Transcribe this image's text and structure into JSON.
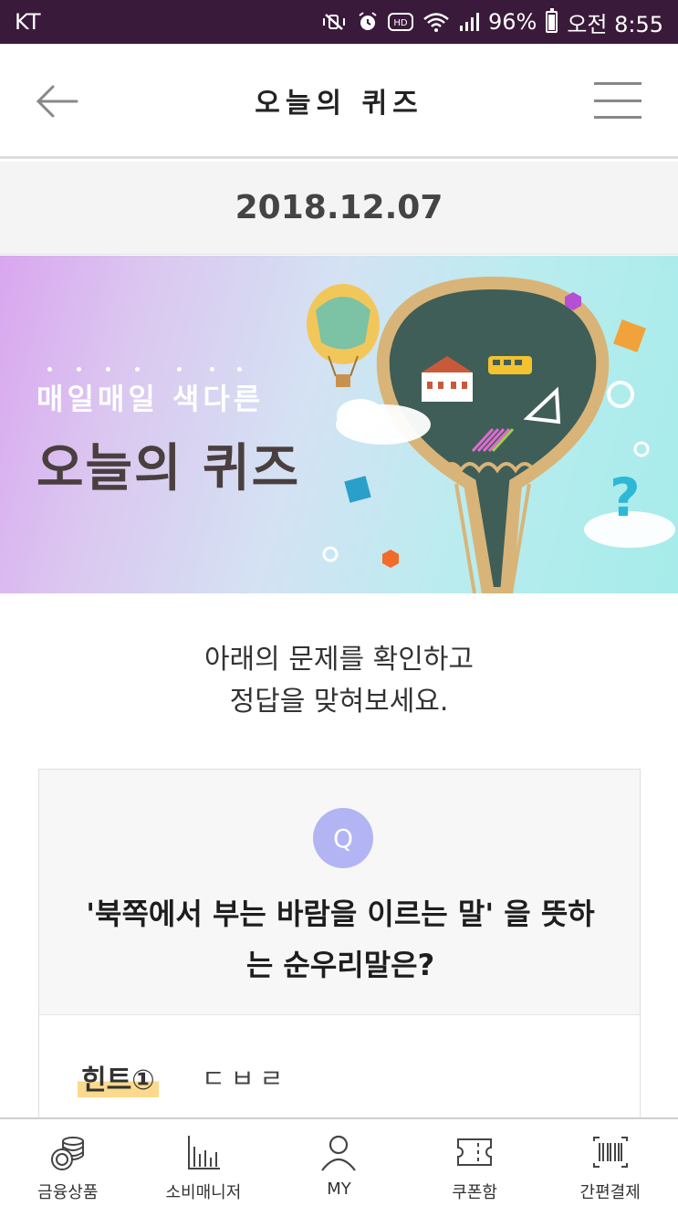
{
  "status_bar": {
    "carrier": "KT",
    "battery": "96%",
    "time": "오전 8:55",
    "icons": [
      "mute-vibrate-icon",
      "alarm-icon",
      "hd-icon",
      "wifi-icon",
      "signal-icon",
      "battery-icon"
    ],
    "hd_label": "HD"
  },
  "header": {
    "title": "오늘의 퀴즈",
    "back_icon": "back-arrow-icon",
    "menu_icon": "menu-icon"
  },
  "date": "2018.12.07",
  "banner": {
    "line1": "매일매일 색다른",
    "line2": "오늘의 퀴즈",
    "illustration": "lightbulb-chalkboard-illustration"
  },
  "intro": {
    "line1": "아래의 문제를 확인하고",
    "line2": "정답을 맞혀보세요."
  },
  "quiz": {
    "badge": "Q",
    "question_line1": "'북쪽에서 부는 바람을 이르는 말' 을 뜻하",
    "question_line2": "는 순우리말은?",
    "hint_label": "힌트①",
    "hint_value": "ㄷㅂㄹ"
  },
  "bottom_nav": {
    "items": [
      {
        "label": "금융상품",
        "icon": "coins-icon"
      },
      {
        "label": "소비매니저",
        "icon": "bar-chart-icon"
      },
      {
        "label": "MY",
        "icon": "person-icon"
      },
      {
        "label": "쿠폰함",
        "icon": "coupon-icon"
      },
      {
        "label": "간편결제",
        "icon": "barcode-icon"
      }
    ]
  },
  "colors": {
    "status_bar": "#3a1a3a",
    "badge": "#b2b4f4",
    "hint_highlight": "#fbd98d"
  }
}
